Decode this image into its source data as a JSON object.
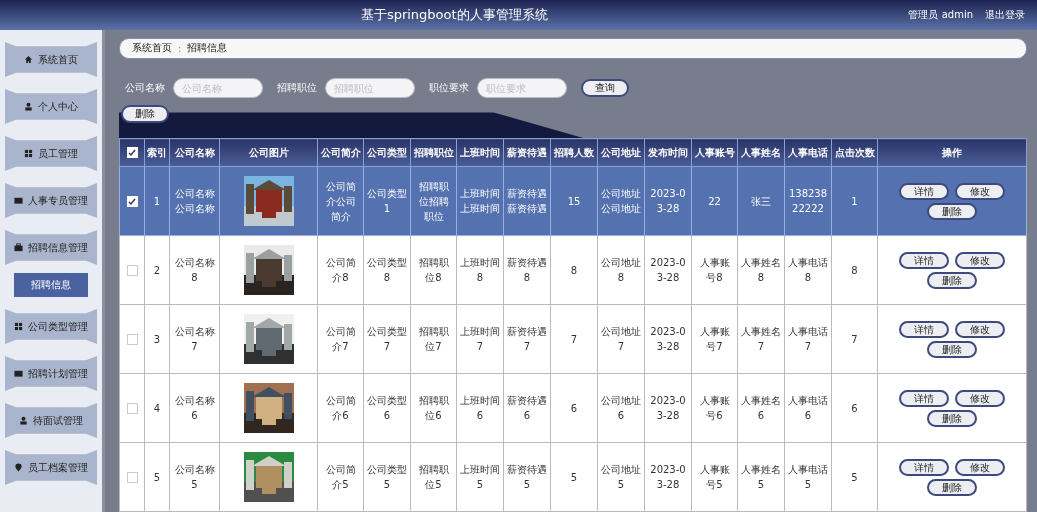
{
  "header": {
    "title": "基于springboot的人事管理系统",
    "user": "管理员 admin",
    "logout": "退出登录"
  },
  "sidebar": {
    "items": [
      {
        "label": "系统首页"
      },
      {
        "label": "个人中心"
      },
      {
        "label": "员工管理"
      },
      {
        "label": "人事专员管理"
      },
      {
        "label": "招聘信息管理",
        "children": [
          {
            "label": "招聘信息",
            "selected": true
          }
        ]
      },
      {
        "label": "公司类型管理"
      },
      {
        "label": "招聘计划管理"
      },
      {
        "label": "待面试管理"
      },
      {
        "label": "员工档案管理"
      }
    ]
  },
  "breadcrumb": {
    "home": "系统首页",
    "separator": ":",
    "current": "招聘信息"
  },
  "search": {
    "fields": [
      {
        "label": "公司名称",
        "placeholder": "公司名称"
      },
      {
        "label": "招聘职位",
        "placeholder": "招聘职位"
      },
      {
        "label": "职位要求",
        "placeholder": "职位要求"
      }
    ],
    "button": "查询"
  },
  "delete_button": "删除",
  "table": {
    "select_all_checked": true,
    "columns": [
      "索引",
      "公司名称",
      "公司图片",
      "公司简介",
      "公司类型",
      "招聘职位",
      "上班时间",
      "薪资待遇",
      "招聘人数",
      "公司地址",
      "发布时间",
      "人事账号",
      "人事姓名",
      "人事电话",
      "点击次数",
      "操作"
    ],
    "rows": [
      {
        "selected": true,
        "cells": [
          "1",
          "公司名称公司名称",
          {
            "kind": "picture"
          },
          "公司简介公司简介",
          "公司类型1",
          "招聘职位招聘职位",
          "上班时间上班时间",
          "薪资待遇薪资待遇",
          "15",
          "公司地址公司地址",
          "2023-03-28",
          "22",
          "张三",
          "13823822222",
          "1"
        ],
        "actions": [
          "详情",
          "修改",
          "删除"
        ]
      },
      {
        "selected": false,
        "cells": [
          "2",
          "公司名称8",
          {
            "kind": "picture"
          },
          "公司简介8",
          "公司类型8",
          "招聘职位8",
          "上班时间8",
          "薪资待遇8",
          "8",
          "公司地址8",
          "2023-03-28",
          "人事账号8",
          "人事姓名8",
          "人事电话8",
          "8"
        ],
        "actions": [
          "详情",
          "修改",
          "删除"
        ]
      },
      {
        "selected": false,
        "cells": [
          "3",
          "公司名称7",
          {
            "kind": "picture"
          },
          "公司简介7",
          "公司类型7",
          "招聘职位7",
          "上班时间7",
          "薪资待遇7",
          "7",
          "公司地址7",
          "2023-03-28",
          "人事账号7",
          "人事姓名7",
          "人事电话7",
          "7"
        ],
        "actions": [
          "详情",
          "修改",
          "删除"
        ]
      },
      {
        "selected": false,
        "cells": [
          "4",
          "公司名称6",
          {
            "kind": "picture"
          },
          "公司简介6",
          "公司类型6",
          "招聘职位6",
          "上班时间6",
          "薪资待遇6",
          "6",
          "公司地址6",
          "2023-03-28",
          "人事账号6",
          "人事姓名6",
          "人事电话6",
          "6"
        ],
        "actions": [
          "详情",
          "修改",
          "删除"
        ]
      },
      {
        "selected": false,
        "cells": [
          "5",
          "公司名称5",
          {
            "kind": "picture"
          },
          "公司简介5",
          "公司类型5",
          "招聘职位5",
          "上班时间5",
          "薪资待遇5",
          "5",
          "公司地址5",
          "2023-03-28",
          "人事账号5",
          "人事姓名5",
          "人事电话5",
          "5"
        ],
        "actions": [
          "详情",
          "修改",
          "删除"
        ]
      }
    ]
  }
}
